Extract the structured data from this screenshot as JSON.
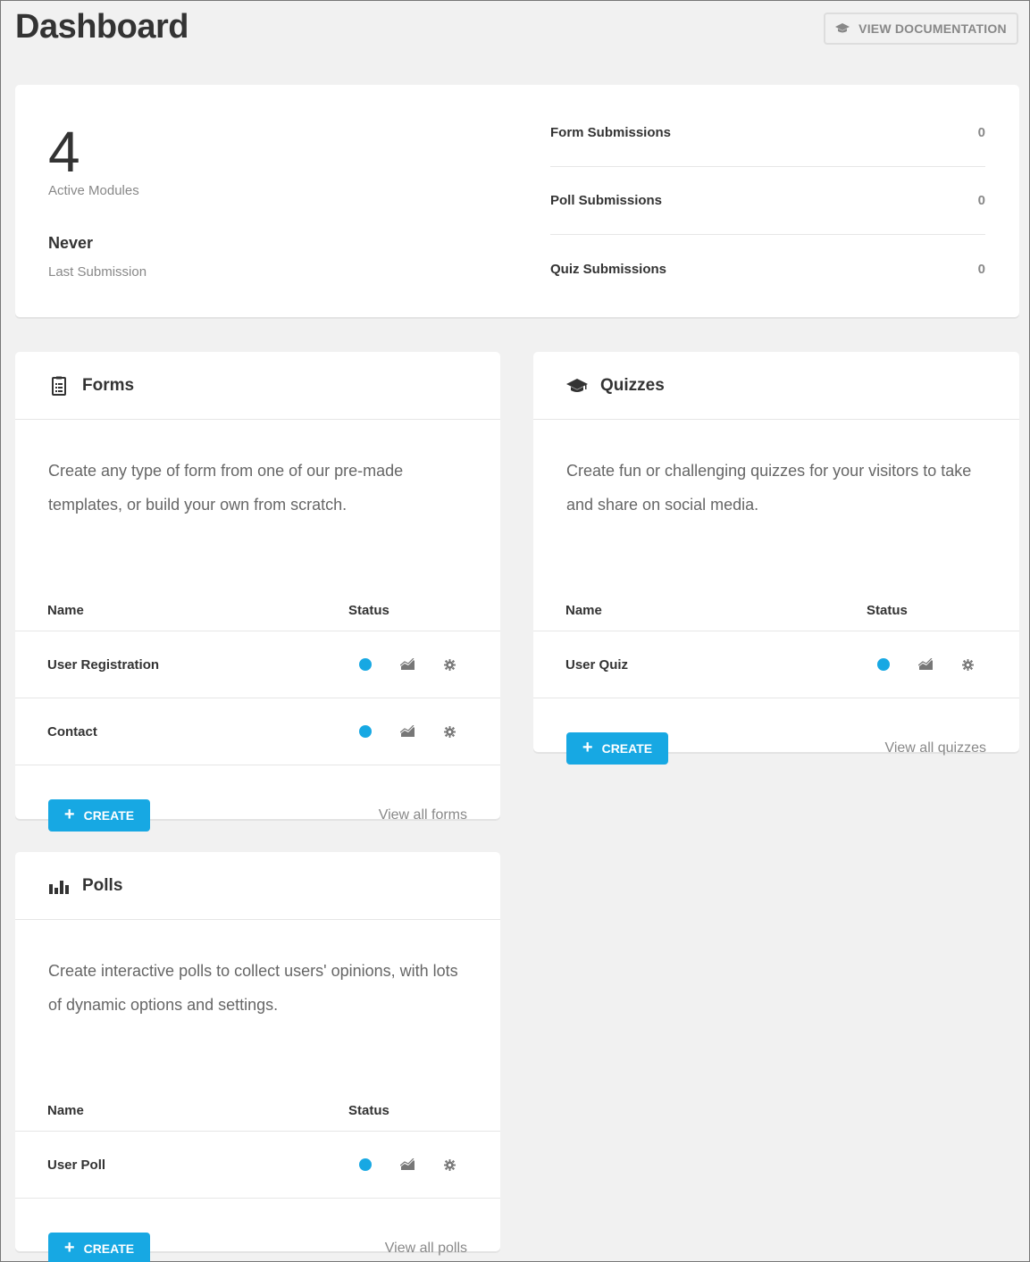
{
  "header": {
    "title": "Dashboard",
    "doc_button": "VIEW DOCUMENTATION"
  },
  "summary": {
    "active_modules_count": "4",
    "active_modules_label": "Active Modules",
    "last_submission_value": "Never",
    "last_submission_label": "Last Submission",
    "stats": [
      {
        "label": "Form Submissions",
        "value": "0"
      },
      {
        "label": "Poll Submissions",
        "value": "0"
      },
      {
        "label": "Quiz Submissions",
        "value": "0"
      }
    ]
  },
  "forms": {
    "title": "Forms",
    "description": "Create any type of form from one of our pre-made templates, or build your own from scratch.",
    "col_name": "Name",
    "col_status": "Status",
    "rows": [
      {
        "name": "User Registration"
      },
      {
        "name": "Contact"
      }
    ],
    "create_label": "CREATE",
    "view_all": "View all forms"
  },
  "quizzes": {
    "title": "Quizzes",
    "description": "Create fun or challenging quizzes for your visitors to take and share on social media.",
    "col_name": "Name",
    "col_status": "Status",
    "rows": [
      {
        "name": "User Quiz"
      }
    ],
    "create_label": "CREATE",
    "view_all": "View all quizzes"
  },
  "polls": {
    "title": "Polls",
    "description": "Create interactive polls to collect users' opinions, with lots of dynamic options and settings.",
    "col_name": "Name",
    "col_status": "Status",
    "rows": [
      {
        "name": "User Poll"
      }
    ],
    "create_label": "CREATE",
    "view_all": "View all polls"
  },
  "colors": {
    "accent": "#17a8e3",
    "background": "#f1f1f1"
  },
  "icons": {
    "doc": "graduation-cap-icon",
    "forms": "clipboard-icon",
    "quizzes": "graduation-cap-icon",
    "polls": "bar-chart-icon",
    "status": "status-dot-icon",
    "submissions": "chart-icon",
    "settings": "gear-icon"
  }
}
